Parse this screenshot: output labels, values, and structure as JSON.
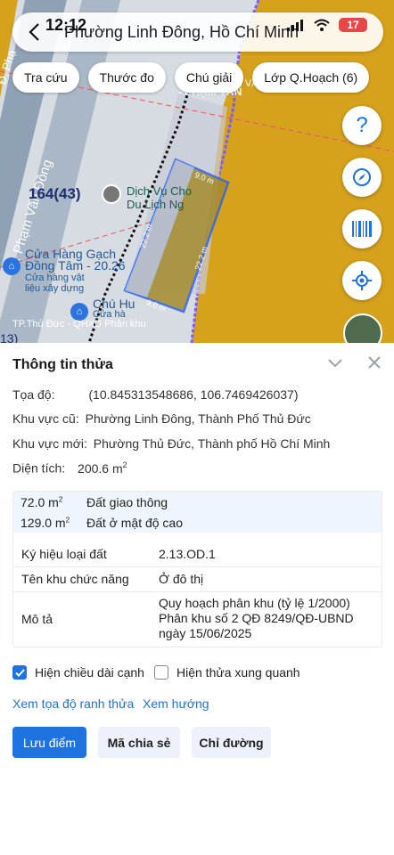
{
  "status_bar": {
    "time": "12:12",
    "battery": "17"
  },
  "search": {
    "title": "Phường Linh Đông, Hồ Chí Minh"
  },
  "chips": [
    "Tra cứu",
    "Thước đo",
    "Chú giải",
    "Lớp Q.Hoạch (6)"
  ],
  "map": {
    "labels": {
      "road_pham_van_dong": "Đ. Phạm Văn Đồng",
      "road_pham_fragment": "Đ. Phạ",
      "road_top_right": "PHẠM VĂN Đ",
      "road_top_right_small": "- PHẠM VĂN",
      "road_top_right_vertical": "VH",
      "plot_code": "164(43)",
      "poi_dichvu": "Dịch Vụ Cho",
      "poi_dulich": "Du Lịch Ng",
      "poi_cuahang": "Cửa Hàng Gạch",
      "poi_dongtam": "Đồng Tâm - 20.26",
      "poi_cuahang_sub1": "Cửa hàng vật",
      "poi_cuahang_sub2": "liệu xây dựng",
      "poi_chuhu": "Chú Hu",
      "poi_cuahang2": "Cửa hà",
      "left_number": "13)",
      "parcel_top": "9.0 m",
      "parcel_right": "22.2 m",
      "parcel_left": "22.2 m",
      "parcel_bottom": "9.0 m",
      "attribution": "TP.Thủ Đức - QHXD Phân khu"
    },
    "colors": {
      "residential": "#d6a21c",
      "road": "#8fa2b5",
      "parcel": "#a58a2c",
      "outline": "#2d63e6"
    }
  },
  "panel": {
    "title": "Thông tin thửa",
    "coord_label": "Tọa độ:",
    "coord_value": "(10.845313548686, 106.7469426037)",
    "old_area_label": "Khu vực cũ:",
    "old_area_value": "Phường Linh Đông,",
    "old_area_value2": "Thành Phố Thủ Đức",
    "new_area_label": "Khu vực mới:",
    "new_area_value": "Phường Thủ Đức, Thành phố Hồ Chí Minh",
    "size_label": "Diện tích:",
    "size_value": "200.6 m",
    "size_unit_sup": "2",
    "land_rows": [
      {
        "area": "72.0 m",
        "sup": "2",
        "type": "Đất giao thông"
      },
      {
        "area": "129.0 m",
        "sup": "2",
        "type": "Đất ở mật độ cao"
      }
    ],
    "kv": [
      {
        "key": "Ký hiệu loại đất",
        "value": "2.13.OD.1"
      },
      {
        "key": "Tên khu chức năng",
        "value": "Ở đô thị"
      },
      {
        "key": "Mô tả",
        "value": "Quy hoạch phân khu (tỷ lệ 1/2000) Phân khu số 2 QĐ 8249/QĐ-UBND ngày 15/06/2025"
      }
    ],
    "checkboxes": [
      {
        "label": "Hiện chiều dài cạnh",
        "checked": true
      },
      {
        "label": "Hiện thửa xung quanh",
        "checked": false
      }
    ],
    "links": [
      "Xem tọa độ ranh thửa",
      "Xem hướng"
    ],
    "buttons": [
      "Lưu điểm",
      "Mã chia sẻ",
      "Chỉ đường"
    ]
  }
}
